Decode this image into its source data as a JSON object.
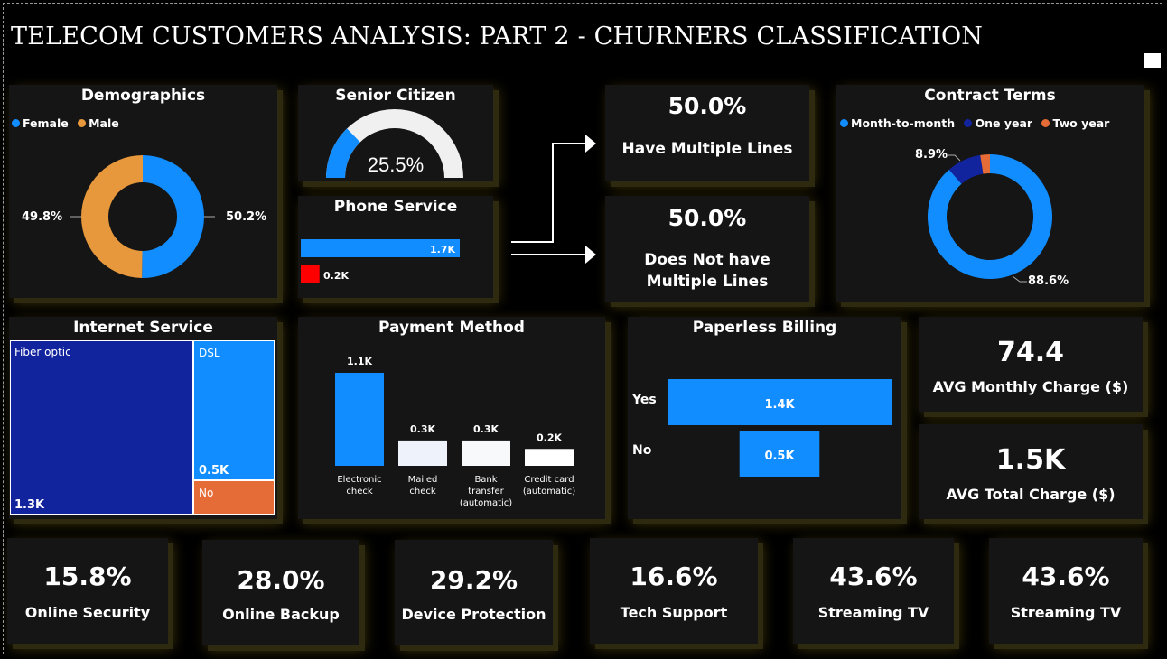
{
  "title": "TELECOM CUSTOMERS ANALYSIS: PART 2 - CHURNERS CLASSIFICATION",
  "colors": {
    "blue": "#118dff",
    "orange": "#e8983c",
    "navy": "#12239e",
    "red_orange": "#e66c37",
    "red": "#ff0000",
    "light": "#f0f0f0"
  },
  "demographics": {
    "title": "Demographics",
    "legend": [
      "Female",
      "Male"
    ],
    "female_label": "50.2%",
    "male_label": "49.8%"
  },
  "senior": {
    "title": "Senior Citizen",
    "value_label": "25.5%"
  },
  "phone": {
    "title": "Phone Service",
    "yes_label": "1.7K",
    "no_label": "0.2K"
  },
  "multiple_lines": {
    "yes_pct": "50.0%",
    "yes_caption": "Have Multiple Lines",
    "no_pct": "50.0%",
    "no_caption": "Does Not have Multiple Lines"
  },
  "contract": {
    "title": "Contract Terms",
    "legend": [
      "Month-to-month",
      "One year",
      "Two year"
    ],
    "mtm_label": "88.6%",
    "one_year_label": "8.9%"
  },
  "internet": {
    "title": "Internet Service",
    "fiber_name": "Fiber optic",
    "fiber_value": "1.3K",
    "dsl_name": "DSL",
    "dsl_value": "0.5K",
    "no_name": "No"
  },
  "payment": {
    "title": "Payment Method"
  },
  "paperless": {
    "title": "Paperless Billing"
  },
  "avg_monthly": {
    "value": "74.4",
    "caption": "AVG Monthly Charge ($)"
  },
  "avg_total": {
    "value": "1.5K",
    "caption": "AVG Total Charge ($)"
  },
  "bottom_kpis": [
    {
      "value": "15.8%",
      "caption": "Online Security"
    },
    {
      "value": "28.0%",
      "caption": "Online Backup"
    },
    {
      "value": "29.2%",
      "caption": "Device Protection"
    },
    {
      "value": "16.6%",
      "caption": "Tech Support"
    },
    {
      "value": "43.6%",
      "caption": "Streaming TV"
    },
    {
      "value": "43.6%",
      "caption": "Streaming TV"
    }
  ],
  "chart_data": [
    {
      "type": "pie",
      "title": "Demographics",
      "categories": [
        "Female",
        "Male"
      ],
      "values": [
        50.2,
        49.8
      ],
      "legend": "top-left",
      "donut": true
    },
    {
      "type": "gauge",
      "title": "Senior Citizen",
      "value": 25.5,
      "range": [
        0,
        100
      ]
    },
    {
      "type": "bar",
      "title": "Phone Service",
      "orientation": "horizontal",
      "categories": [
        "",
        ""
      ],
      "values": [
        1.7,
        0.2
      ],
      "value_labels": [
        "1.7K",
        "0.2K"
      ]
    },
    {
      "type": "pie",
      "title": "Contract Terms",
      "categories": [
        "Month-to-month",
        "One year",
        "Two year"
      ],
      "values": [
        88.6,
        8.9,
        2.5
      ],
      "legend": "top-left",
      "donut": true
    },
    {
      "type": "treemap",
      "title": "Internet Service",
      "categories": [
        "Fiber optic",
        "DSL",
        "No"
      ],
      "values": [
        1.3,
        0.5,
        0.1
      ],
      "value_labels": [
        "1.3K",
        "0.5K",
        ""
      ]
    },
    {
      "type": "bar",
      "title": "Payment Method",
      "categories": [
        "Electronic check",
        "Mailed check",
        "Bank transfer (automatic)",
        "Credit card (automatic)"
      ],
      "values": [
        1.1,
        0.3,
        0.3,
        0.2
      ],
      "value_labels": [
        "1.1K",
        "0.3K",
        "0.3K",
        "0.2K"
      ]
    },
    {
      "type": "bar",
      "title": "Paperless Billing",
      "orientation": "horizontal",
      "categories": [
        "Yes",
        "No"
      ],
      "values": [
        1.4,
        0.5
      ],
      "value_labels": [
        "1.4K",
        "0.5K"
      ]
    }
  ]
}
